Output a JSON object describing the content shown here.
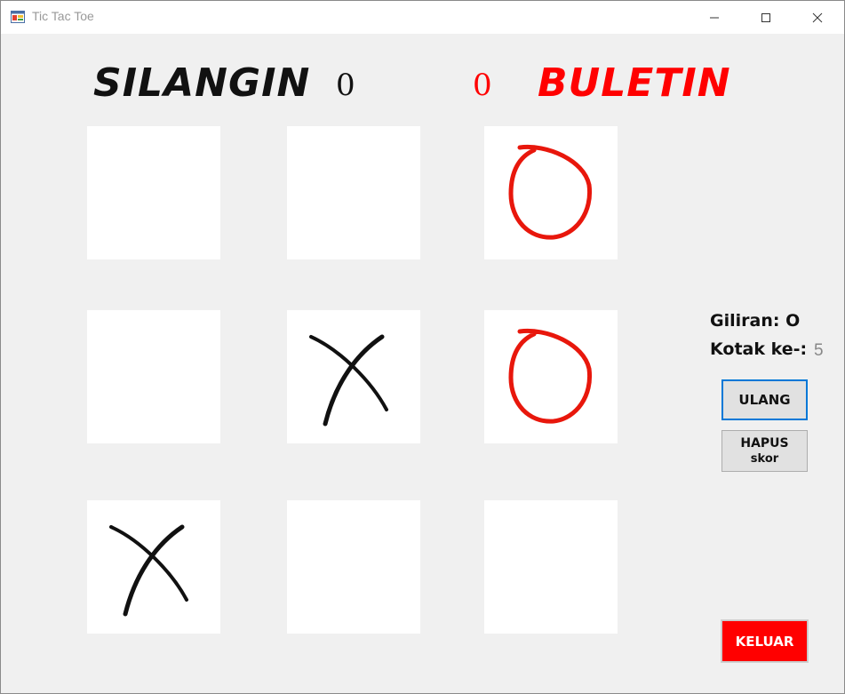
{
  "window": {
    "title": "Tic Tac Toe",
    "icon": "app-window-icon",
    "controls": [
      "minimize-icon",
      "maximize-icon",
      "close-icon"
    ]
  },
  "players": {
    "x": {
      "name": "SILANGIN",
      "score": "0",
      "color": "#111111"
    },
    "o": {
      "name": "BULETIN",
      "score": "0",
      "color": "#ff0000"
    }
  },
  "board": [
    [
      "",
      "",
      "O"
    ],
    [
      "",
      "X",
      "O"
    ],
    [
      "X",
      "",
      ""
    ]
  ],
  "status": {
    "turn_label": "Giliran: O",
    "box_label": "Kotak ke-:",
    "box_value": "5"
  },
  "buttons": {
    "reset_label": "ULANG",
    "clear_label": "HAPUS",
    "clear_sub": "skor",
    "exit_label": "KELUAR"
  },
  "colors": {
    "accent": "#0078d7",
    "exit_bg": "#ff0000",
    "x_mark": "#111111",
    "o_mark": "#e8170c"
  }
}
